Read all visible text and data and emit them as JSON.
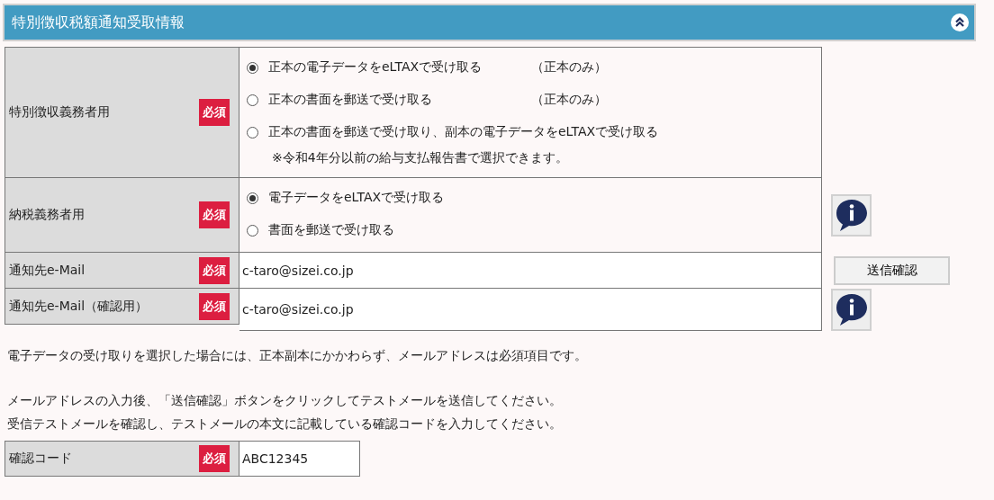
{
  "panel": {
    "title": "特別徴収税額通知受取情報",
    "expanded": true
  },
  "rows": [
    {
      "kind": "radio",
      "label": "特別徴収義務者用",
      "required": "必須",
      "options": [
        {
          "label": "正本の電子データをeLTAXで受け取る",
          "note": "（正本のみ）",
          "selected": true
        },
        {
          "label": "正本の書面を郵送で受け取る",
          "note": "（正本のみ）",
          "selected": false
        },
        {
          "label": "正本の書面を郵送で受け取り、副本の電子データをeLTAXで受け取る",
          "selected": false
        }
      ],
      "remark": "※令和4年分以前の給与支払報告書で選択できます。"
    },
    {
      "kind": "radio",
      "label": "納税義務者用",
      "required": "必須",
      "options": [
        {
          "label": "電子データをeLTAXで受け取る",
          "selected": true
        },
        {
          "label": "書面を郵送で受け取る",
          "selected": false
        }
      ],
      "side": {
        "kind": "info"
      }
    },
    {
      "kind": "email",
      "label": "通知先e-Mail",
      "required": "必須",
      "value": "c-taro@sizei.co.jp",
      "side": {
        "kind": "button",
        "label": "送信確認"
      }
    },
    {
      "kind": "email",
      "label": "通知先e-Mail（確認用）",
      "required": "必須",
      "value": "c-taro@sizei.co.jp",
      "side": {
        "kind": "info"
      }
    }
  ],
  "notes": [
    [
      "電子データの受け取りを選択した場合には、正本副本にかかわらず、メールアドレスは必須項目です。"
    ],
    [
      "メールアドレスの入力後、「送信確認」ボタンをクリックしてテストメールを送信してください。",
      "受信テストメールを確認し、テストメールの本文に記載している確認コードを入力してください。"
    ]
  ],
  "code": {
    "label": "確認コード",
    "required": "必須",
    "value": "ABC12345"
  }
}
